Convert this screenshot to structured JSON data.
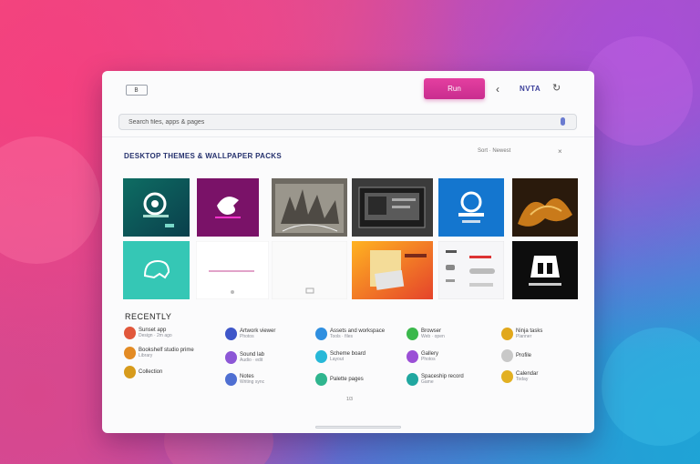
{
  "header": {
    "logo_text": "B",
    "primary_button": "Run",
    "back_icon": "chevron-left-icon",
    "account_label": "NVTA",
    "refresh_icon": "refresh-icon"
  },
  "search": {
    "value": "Search files, apps & pages"
  },
  "featured": {
    "title": "DESKTOP THEMES & WALLPAPER PACKS",
    "sort_label": "Sort · Newest",
    "more_icon": "close-icon"
  },
  "recent": {
    "title": "RECENTLY",
    "items": [
      {
        "title": "Sunset app",
        "subtitle": "Design · 2m ago",
        "color": "#e1573b"
      },
      {
        "title": "Bookshelf studio prime",
        "subtitle": "Library",
        "color": "#e38b24"
      },
      {
        "title": "Collection",
        "subtitle": "",
        "color": "#d79b1c"
      },
      {
        "title": "Artwork viewer",
        "subtitle": "Photos",
        "color": "#3e56c9"
      },
      {
        "title": "Sound lab",
        "subtitle": "Audio · edit",
        "color": "#8c57d6"
      },
      {
        "title": "Notes",
        "subtitle": "Writing sync",
        "color": "#4f6fd2"
      },
      {
        "title": "Assets and workspace",
        "subtitle": "Tools · files",
        "color": "#2f8fe0"
      },
      {
        "title": "Scheme board",
        "subtitle": "Layout",
        "color": "#27b8d8"
      },
      {
        "title": "Palette pages",
        "subtitle": "",
        "color": "#2fb58e"
      },
      {
        "title": "Browser",
        "subtitle": "Web · open",
        "color": "#3bb84c"
      },
      {
        "title": "Gallery",
        "subtitle": "Photos",
        "color": "#9b4fd6"
      },
      {
        "title": "Spaceship record",
        "subtitle": "Game",
        "color": "#20a7a0"
      },
      {
        "title": "Ninja tasks",
        "subtitle": "Planner",
        "color": "#e1a81c"
      },
      {
        "title": "Profile",
        "subtitle": "",
        "color": "#c8c8c8"
      },
      {
        "title": "Calendar",
        "subtitle": "Today",
        "color": "#e2b022"
      }
    ],
    "page_marker": "1/3"
  }
}
